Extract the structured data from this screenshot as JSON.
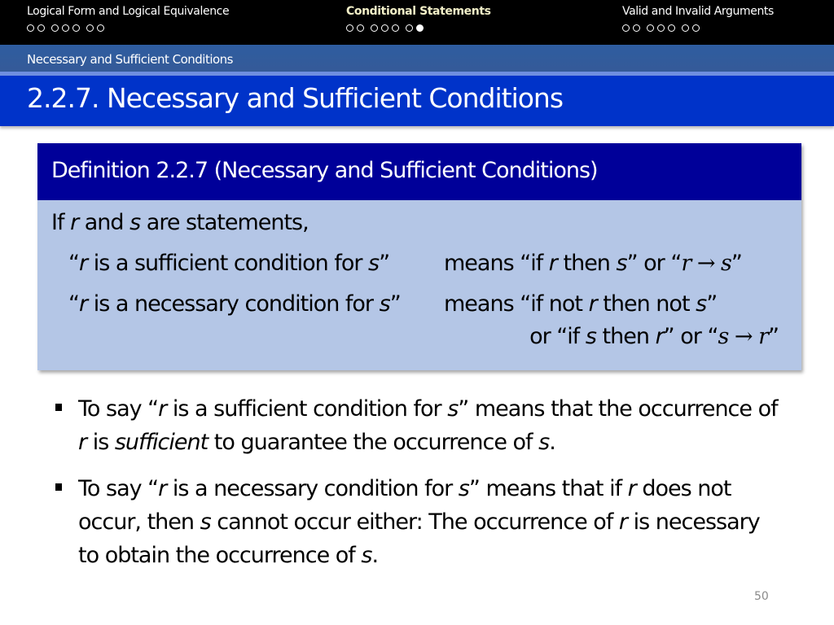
{
  "nav": {
    "sections": [
      {
        "title": "Logical Form and Logical Equivalence",
        "active": false,
        "dots": [
          [
            0,
            0
          ],
          [
            0,
            0,
            0
          ],
          [
            0,
            0
          ]
        ]
      },
      {
        "title": "Conditional Statements",
        "active": true,
        "dots": [
          [
            0,
            0
          ],
          [
            0,
            0,
            0
          ],
          [
            0,
            1
          ]
        ]
      },
      {
        "title": "Valid and Invalid Arguments",
        "active": false,
        "dots": [
          [
            0,
            0
          ],
          [
            0,
            0,
            0
          ],
          [
            0,
            0
          ]
        ]
      }
    ]
  },
  "subsection": "Necessary and Sufficient Conditions",
  "slide_title": "2.2.7. Necessary and Sufficient Conditions",
  "definition": {
    "header": "Definition 2.2.7 (Necessary and Sufficient Conditions)",
    "intro": {
      "a": "If ",
      "r": "r",
      "b": " and ",
      "s": "s",
      "c": " are statements,"
    },
    "sufficient": {
      "q_open": "“",
      "r": "r",
      "text": " is a sufficient condition for ",
      "s": "s",
      "q_close": "”",
      "means": "means “if ",
      "r2": "r",
      "then": " then ",
      "s2": "s",
      "or": "” or “",
      "formula": "r → s",
      "end": "”"
    },
    "necessary": {
      "q_open": "“",
      "r": "r",
      "text": " is a necessary condition for ",
      "s": "s",
      "q_close": "”",
      "means": "means “if not ",
      "r2": "r",
      "then": " then not ",
      "s2": "s",
      "end": "”"
    },
    "necessary_alt": {
      "a": "or “if ",
      "s": "s",
      "b": " then ",
      "r": "r",
      "c": "” or “",
      "formula": "s → r",
      "end": "”"
    }
  },
  "bullets": [
    {
      "parts": [
        {
          "t": "To say “"
        },
        {
          "t": "r",
          "i": true
        },
        {
          "t": " is a sufficient condition for "
        },
        {
          "t": "s",
          "i": true
        },
        {
          "t": "” means that the occurrence of "
        },
        {
          "t": "r",
          "i": true
        },
        {
          "t": " is "
        },
        {
          "t": "sufficient",
          "i": true
        },
        {
          "t": " to guarantee the occurrence of "
        },
        {
          "t": "s",
          "i": true
        },
        {
          "t": "."
        }
      ]
    },
    {
      "parts": [
        {
          "t": "To say “"
        },
        {
          "t": "r",
          "i": true
        },
        {
          "t": " is a necessary condition for "
        },
        {
          "t": "s",
          "i": true
        },
        {
          "t": "” means that if "
        },
        {
          "t": "r",
          "i": true
        },
        {
          "t": " does not occur, then "
        },
        {
          "t": "s",
          "i": true
        },
        {
          "t": " cannot occur either: The occurrence of "
        },
        {
          "t": "r",
          "i": true
        },
        {
          "t": " is necessary to obtain the occurrence of "
        },
        {
          "t": "s",
          "i": true
        },
        {
          "t": "."
        }
      ]
    }
  ],
  "page_number": "50",
  "colors": {
    "nav_bg": "#000000",
    "subbar_bg": "#2e5da0",
    "title_bg": "#0033c9",
    "def_header_bg": "#000099",
    "def_body_bg": "#b4c6e6"
  }
}
